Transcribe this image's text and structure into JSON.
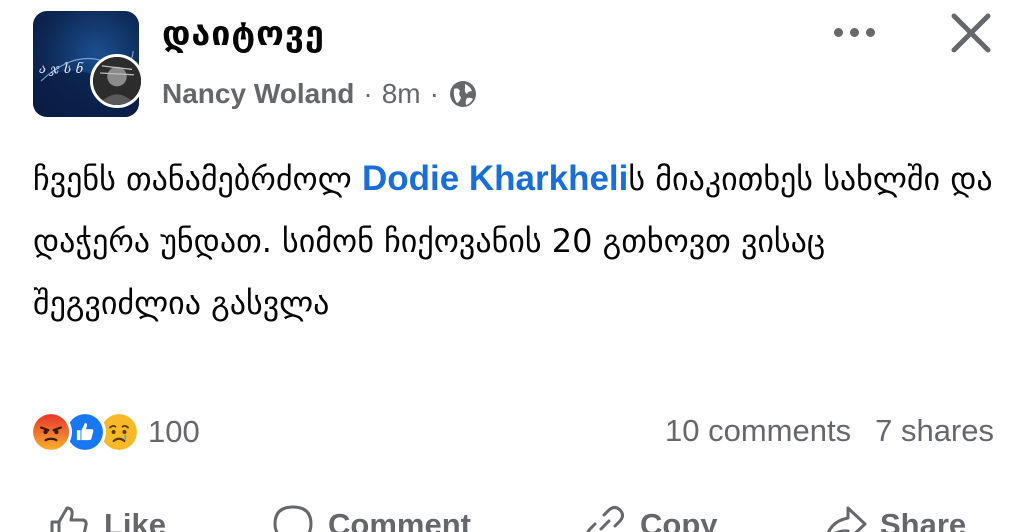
{
  "header": {
    "group_name": "დაიტოვე",
    "author": "Nancy Woland",
    "separator": "·",
    "time": "8m",
    "audience_icon": "globe-icon",
    "more_icon": "more-horizontal-icon",
    "close_icon": "close-icon",
    "group_avatar_text": "ა ჯ ს ნ"
  },
  "post": {
    "text_before_mention": "ჩვენს თანამებრძოლ ",
    "mention": "Dodie Kharkheli",
    "text_after_mention": "ს მიაკითხეს სახლში და დაჭერა უნდათ. სიმონ ჩიქოვანის 20 გთხოვთ ვისაც შეგვიძლია გასვლა"
  },
  "stats": {
    "reactions": [
      "angry",
      "like",
      "sad"
    ],
    "reaction_count": "100",
    "comments": "10 comments",
    "shares": "7 shares"
  },
  "actions": {
    "like": "Like",
    "comment": "Comment",
    "copy": "Copy",
    "share": "Share"
  },
  "colors": {
    "mention": "#1a6ed8",
    "meta_text": "#65676b",
    "like_blue": "#1877f2",
    "angry_orange": "#f0592b",
    "sad_yellow": "#f7b928"
  }
}
